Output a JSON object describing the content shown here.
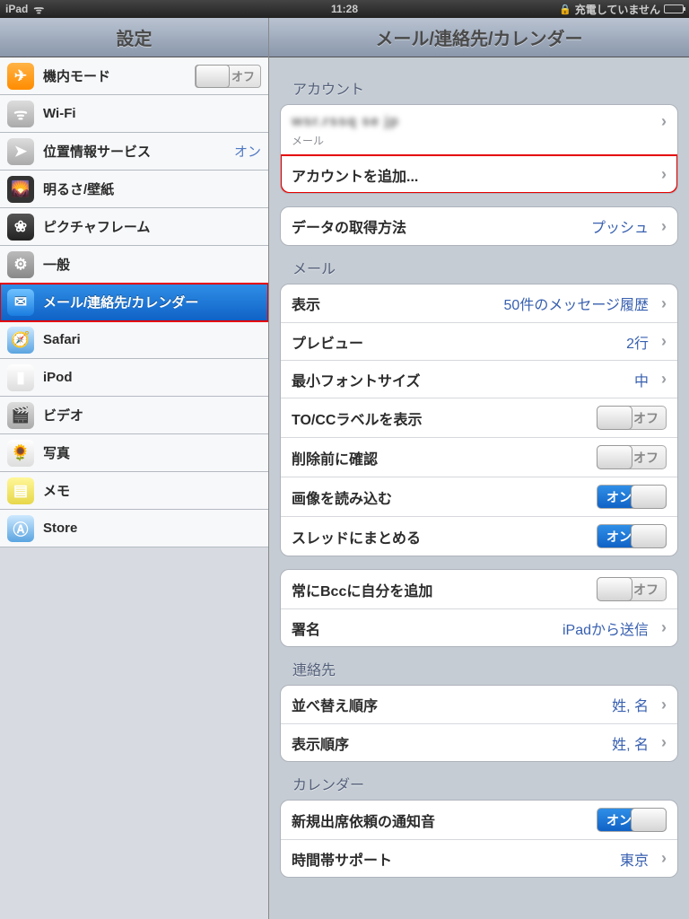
{
  "status": {
    "device": "iPad",
    "time": "11:28",
    "charging_text": "充電していません"
  },
  "sidebar": {
    "title": "設定",
    "items": [
      {
        "label": "機内モード",
        "toggle_off": "オフ"
      },
      {
        "label": "Wi-Fi",
        "value": ""
      },
      {
        "label": "位置情報サービス",
        "value": "オン"
      },
      {
        "label": "明るさ/壁紙"
      },
      {
        "label": "ピクチャフレーム"
      },
      {
        "label": "一般"
      },
      {
        "label": "メール/連絡先/カレンダー"
      },
      {
        "label": "Safari"
      },
      {
        "label": "iPod"
      },
      {
        "label": "ビデオ"
      },
      {
        "label": "写真"
      },
      {
        "label": "メモ"
      },
      {
        "label": "Store"
      }
    ]
  },
  "detail": {
    "title": "メール/連絡先/カレンダー",
    "accounts_label": "アカウント",
    "account_blur": "wsr.rssq se jp",
    "account_sub": "メール",
    "add_account": "アカウントを追加...",
    "fetch_label": "データの取得方法",
    "fetch_value": "プッシュ",
    "mail_label": "メール",
    "show": "表示",
    "show_value": "50件のメッセージ履歴",
    "preview": "プレビュー",
    "preview_value": "2行",
    "min_font": "最小フォントサイズ",
    "min_font_value": "中",
    "tocc": "TO/CCラベルを表示",
    "confirm_delete": "削除前に確認",
    "load_images": "画像を読み込む",
    "thread": "スレッドにまとめる",
    "bcc_self": "常にBccに自分を追加",
    "signature": "署名",
    "signature_value": "iPadから送信",
    "contacts_label": "連絡先",
    "sort_order": "並べ替え順序",
    "sort_order_value": "姓, 名",
    "display_order": "表示順序",
    "display_order_value": "姓, 名",
    "calendar_label": "カレンダー",
    "new_invite": "新規出席依頼の通知音",
    "tz_support": "時間帯サポート",
    "tz_value": "東京",
    "on": "オン",
    "off": "オフ"
  }
}
